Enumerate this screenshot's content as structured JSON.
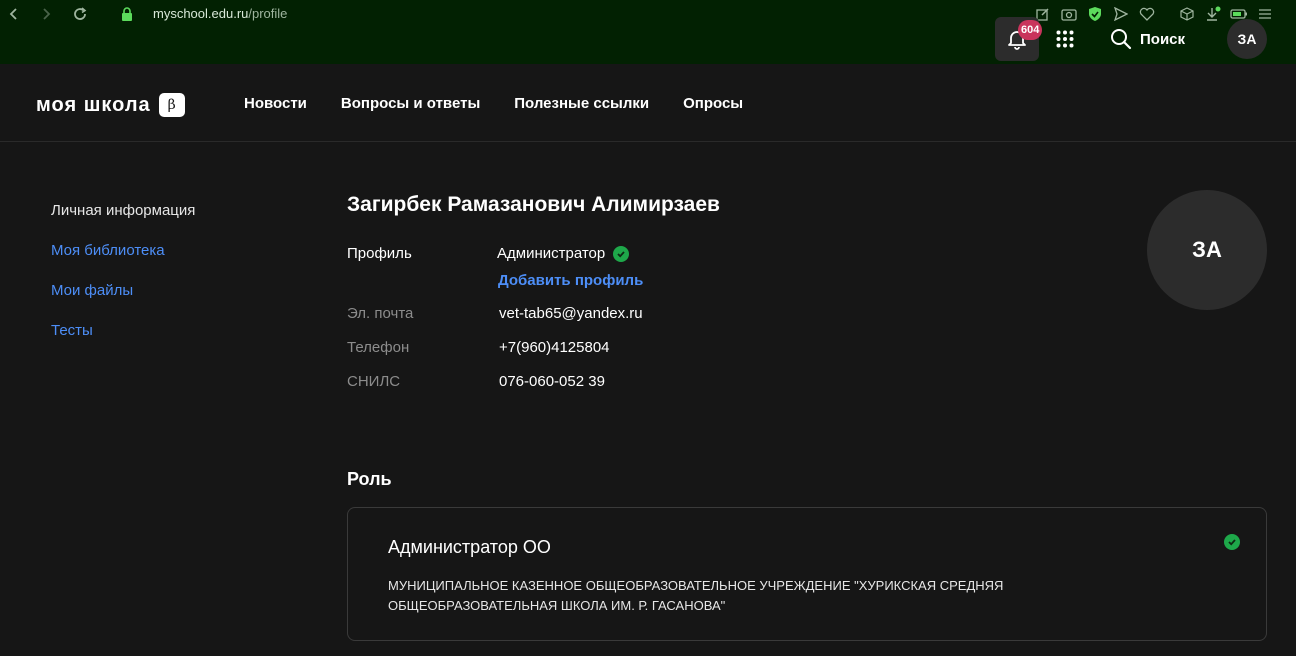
{
  "browser": {
    "url_host": "myschool.edu.ru",
    "url_path": "/profile"
  },
  "header": {
    "logo_text": "моя школа",
    "beta_label": "β",
    "nav": [
      "Новости",
      "Вопросы и ответы",
      "Полезные ссылки",
      "Опросы"
    ],
    "notification_count": "604",
    "search_label": "Поиск",
    "avatar_initials": "ЗА"
  },
  "sidebar": {
    "items": [
      {
        "label": "Личная информация",
        "active": true
      },
      {
        "label": "Моя библиотека",
        "active": false
      },
      {
        "label": "Мои файлы",
        "active": false
      },
      {
        "label": "Тесты",
        "active": false
      }
    ]
  },
  "profile": {
    "full_name": "Загирбек Рамазанович Алимирзаев",
    "profile_label": "Профиль",
    "profile_value": "Администратор",
    "add_profile": "Добавить профиль",
    "email_label": "Эл. почта",
    "email_value": "vet-tab65@yandex.ru",
    "phone_label": "Телефон",
    "phone_value": "+7(960)4125804",
    "snils_label": "СНИЛС",
    "snils_value": "076-060-052 39",
    "avatar_initials": "ЗА"
  },
  "role": {
    "title": "Роль",
    "name": "Администратор ОО",
    "org": "МУНИЦИПАЛЬНОЕ КАЗЕННОЕ ОБЩЕОБРАЗОВАТЕЛЬНОЕ УЧРЕЖДЕНИЕ \"ХУРИКСКАЯ СРЕДНЯЯ ОБЩЕОБРАЗОВАТЕЛЬНАЯ ШКОЛА ИМ. Р. ГАСАНОВА\""
  },
  "colors": {
    "link": "#4d8ef7",
    "check": "#1ea84a",
    "badge": "#c9345c"
  }
}
